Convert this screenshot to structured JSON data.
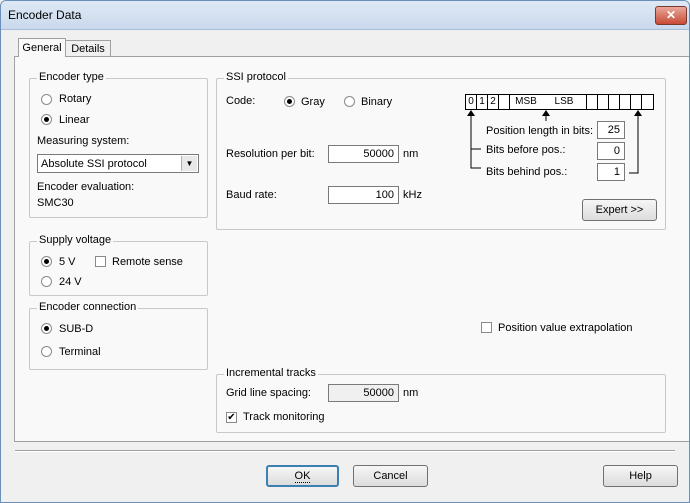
{
  "window": {
    "title": "Encoder Data",
    "close_glyph": "✕"
  },
  "tabs": [
    "General",
    "Details"
  ],
  "encoder_type": {
    "label": "Encoder type",
    "options": [
      "Rotary",
      "Linear"
    ],
    "selected": "Linear",
    "measuring_label": "Measuring system:",
    "measuring_value": "Absolute SSI protocol",
    "evaluation_label": "Encoder evaluation:",
    "evaluation_value": "SMC30"
  },
  "supply_voltage": {
    "label": "Supply voltage",
    "options": [
      "5 V",
      "24 V"
    ],
    "selected": "5 V",
    "remote_sense_label": "Remote sense",
    "remote_sense_checked": false
  },
  "encoder_connection": {
    "label": "Encoder connection",
    "options": [
      "SUB-D",
      "Terminal"
    ],
    "selected": "SUB-D"
  },
  "ssi": {
    "label": "SSI protocol",
    "code_label": "Code:",
    "code_options": [
      "Gray",
      "Binary"
    ],
    "code_selected": "Gray",
    "resolution_label": "Resolution per bit:",
    "resolution_value": "50000",
    "resolution_unit": "nm",
    "baud_label": "Baud rate:",
    "baud_value": "100",
    "baud_unit": "kHz",
    "bit_cells": [
      "0",
      "1",
      "2",
      "",
      "MSB",
      "LSB",
      "",
      "",
      "",
      "",
      "",
      ""
    ],
    "position_length_label": "Position length in bits:",
    "position_length_value": "25",
    "bits_before_label": "Bits before pos.:",
    "bits_before_value": "0",
    "bits_behind_label": "Bits behind pos.:",
    "bits_behind_value": "1",
    "expert_label": "Expert >>"
  },
  "extrapolation": {
    "label": "Position value extrapolation",
    "checked": false
  },
  "incremental": {
    "label": "Incremental tracks",
    "grid_label": "Grid line spacing:",
    "grid_value": "50000",
    "grid_unit": "nm",
    "track_label": "Track monitoring",
    "track_checked": true
  },
  "footer": {
    "ok": "OK",
    "cancel": "Cancel",
    "help": "Help"
  }
}
